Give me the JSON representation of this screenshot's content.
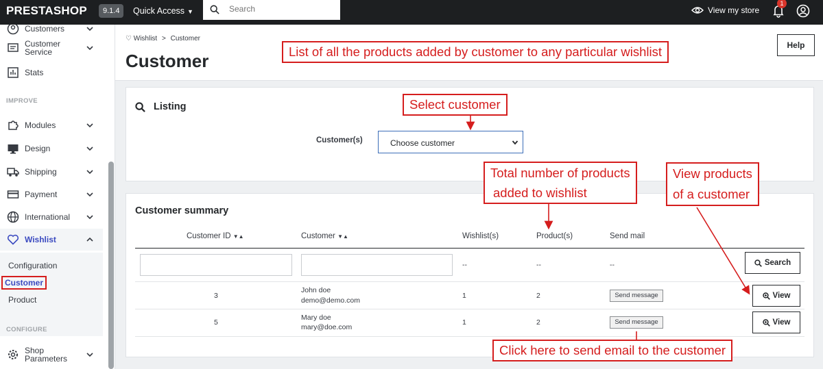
{
  "topbar": {
    "logo": "PRESTASHOP",
    "version": "9.1.4",
    "quick_access": "Quick Access",
    "search_placeholder": "Search",
    "view_store": "View my store",
    "notification_count": "1"
  },
  "sidebar": {
    "items_top": [
      {
        "label": "Customers",
        "icon": "customers-icon"
      },
      {
        "label": "Customer\nService",
        "icon": "customer-service-icon"
      },
      {
        "label": "Stats",
        "icon": "stats-icon"
      }
    ],
    "section_improve": "IMPROVE",
    "items_improve": [
      {
        "label": "Modules",
        "icon": "modules-icon"
      },
      {
        "label": "Design",
        "icon": "design-icon"
      },
      {
        "label": "Shipping",
        "icon": "shipping-icon"
      },
      {
        "label": "Payment",
        "icon": "payment-icon"
      },
      {
        "label": "International",
        "icon": "globe-icon"
      },
      {
        "label": "Wishlist",
        "icon": "heart-icon"
      }
    ],
    "wishlist_sub": [
      "Configuration",
      "Customer",
      "Product"
    ],
    "section_configure": "CONFIGURE",
    "items_configure": [
      {
        "label": "Shop\nParameters",
        "icon": "gear-icon"
      }
    ]
  },
  "header": {
    "breadcrumb_parent": "Wishlist",
    "breadcrumb_sep": ">",
    "breadcrumb_current": "Customer",
    "title": "Customer",
    "help": "Help"
  },
  "listing": {
    "title": "Listing",
    "customer_label": "Customer(s)",
    "select_value": "Choose customer"
  },
  "summary": {
    "title": "Customer summary",
    "columns": [
      "Customer ID",
      "Customer",
      "Wishlist(s)",
      "Product(s)",
      "Send mail"
    ],
    "filter_placeholder": "--",
    "search_button": "Search",
    "rows": [
      {
        "id": "3",
        "name": "John doe",
        "email": "demo@demo.com",
        "wishlists": "1",
        "products": "2",
        "send": "Send message",
        "view": "View"
      },
      {
        "id": "5",
        "name": "Mary doe",
        "email": "mary@doe.com",
        "wishlists": "1",
        "products": "2",
        "send": "Send message",
        "view": "View"
      }
    ]
  },
  "annotations": {
    "list_all": "List of all the products added by customer to any particular wishlist",
    "select_customer": "Select customer",
    "total_products_1": "Total number of products",
    "total_products_2": "added to wishlist",
    "view_products_1": "View products",
    "view_products_2": "of a customer",
    "send_email": "Click here to send email to the customer"
  },
  "colors": {
    "annotation": "#d51d1d",
    "active": "#3b4ac0",
    "topbar": "#1d1f21"
  }
}
